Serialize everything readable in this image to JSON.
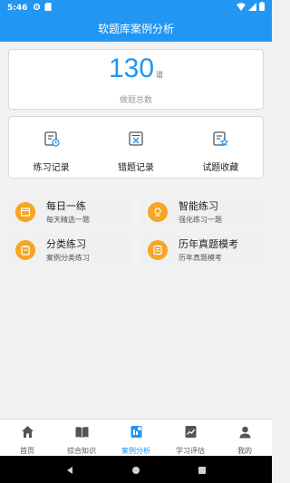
{
  "status": {
    "time": "5:46"
  },
  "app": {
    "title": "软题库案例分析"
  },
  "total": {
    "count": "130",
    "unit": "道",
    "label": "做题总数"
  },
  "records": [
    {
      "label": "练习记录",
      "icon": "practice-record-icon"
    },
    {
      "label": "错题记录",
      "icon": "wrong-record-icon"
    },
    {
      "label": "试题收藏",
      "icon": "favorite-icon"
    }
  ],
  "tiles": [
    {
      "title": "每日一练",
      "subtitle": "每天精选一题",
      "icon": "calendar-icon"
    },
    {
      "title": "智能练习",
      "subtitle": "强化练习一题",
      "icon": "brain-icon"
    },
    {
      "title": "分类练习",
      "subtitle": "案例分类练习",
      "icon": "clipboard-icon"
    },
    {
      "title": "历年真题模考",
      "subtitle": "历年真题模考",
      "icon": "exam-icon"
    }
  ],
  "nav": [
    {
      "label": "首页",
      "icon": "home-icon"
    },
    {
      "label": "综合知识",
      "icon": "book-icon"
    },
    {
      "label": "案例分析",
      "icon": "case-icon",
      "active": true
    },
    {
      "label": "学习评估",
      "icon": "chart-icon"
    },
    {
      "label": "我的",
      "icon": "user-icon"
    }
  ],
  "colors": {
    "primary": "#2196f3",
    "accent": "#f5a623"
  }
}
